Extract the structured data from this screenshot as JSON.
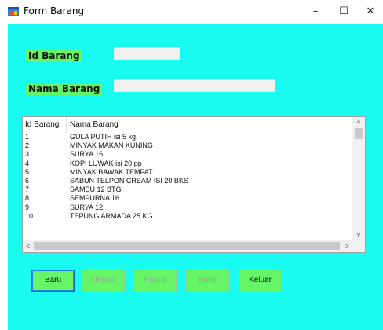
{
  "window": {
    "title": "Form Barang",
    "minimize": "–",
    "maximize": "☐",
    "close": "✕"
  },
  "fields": {
    "id_label": "Id Barang",
    "id_value": "",
    "nama_label": "Nama Barang",
    "nama_value": ""
  },
  "grid": {
    "columns": [
      "Id Barang",
      "Nama Barang"
    ],
    "rows": [
      [
        "1",
        "GULA PUTIH isi 5 kg."
      ],
      [
        "2",
        "MINYAK MAKAN KUNING"
      ],
      [
        "3",
        "SURYA 16"
      ],
      [
        "4",
        "KOPI LUWAK isi 20 pp"
      ],
      [
        "5",
        "MINYAK BAWAK TEMPAT"
      ],
      [
        "6",
        "SABUN TELPON CREAM ISI 20 BKS"
      ],
      [
        "7",
        "SAMSU 12 BTG"
      ],
      [
        "8",
        "SEMPURNA 16"
      ],
      [
        "9",
        "SURYA 12"
      ],
      [
        "10",
        "TEPUNG ARMADA 25 KG"
      ]
    ],
    "scroll_up": "^",
    "scroll_down": "v",
    "scroll_left": "<",
    "scroll_right": ">"
  },
  "buttons": {
    "baru": "Baru",
    "simpan": "Simpan",
    "hapus": "Hapus",
    "batal": "Batal",
    "keluar": "Keluar"
  },
  "colors": {
    "background": "#19FBF1",
    "label_bg": "#66F566",
    "button_bg": "#66F566"
  }
}
